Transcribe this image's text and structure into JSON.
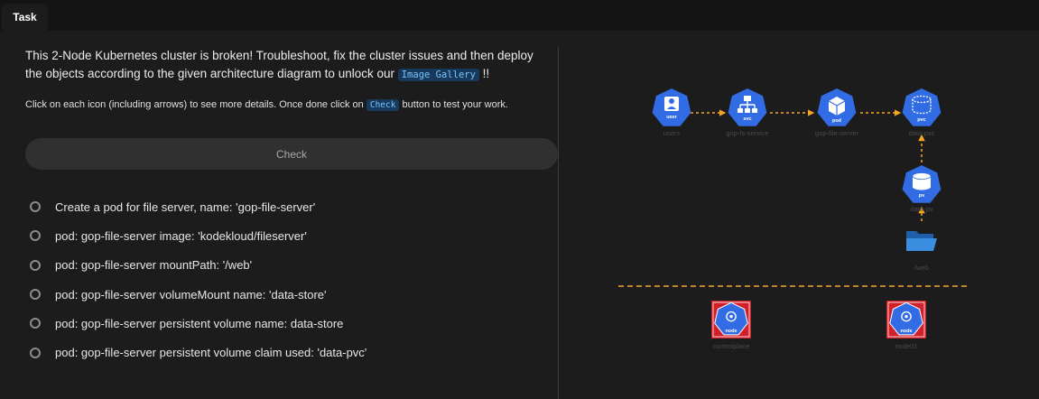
{
  "tab": {
    "label": "Task"
  },
  "intro": {
    "line1": "This 2-Node Kubernetes cluster is broken! Troubleshoot, fix the cluster issues and then deploy",
    "line2_pre": "the objects according to the given architecture diagram to unlock our ",
    "line2_code": "Image Gallery",
    "line2_post": " !!"
  },
  "hint": {
    "pre": "Click on each icon (including arrows) to see more details. Once done click on ",
    "code": "Check",
    "post": " button to test your work."
  },
  "check_button": {
    "label": "Check"
  },
  "tasks": [
    "Create a pod for file server, name: 'gop-file-server'",
    "pod: gop-file-server image: 'kodekloud/fileserver'",
    "pod: gop-file-server mountPath: '/web'",
    "pod: gop-file-server volumeMount name: 'data-store'",
    "pod: gop-file-server persistent volume name: data-store",
    "pod: gop-file-server persistent volume claim used: 'data-pvc'"
  ],
  "diagram": {
    "users": {
      "badge": "user",
      "label": "users"
    },
    "svc": {
      "badge": "svc",
      "label": "gop-fs-service"
    },
    "pod": {
      "badge": "pod",
      "label": "gop-file-server"
    },
    "pvc": {
      "badge": "pvc",
      "label": "data-pvc"
    },
    "pv": {
      "badge": "pv",
      "label": "data-pv"
    },
    "folder": {
      "label": "/web"
    },
    "controlplane": {
      "badge": "node",
      "label": "controlplane"
    },
    "node01": {
      "badge": "node",
      "label": "node01"
    }
  },
  "colors": {
    "k8s_blue": "#326ce5",
    "arrow_orange": "#f5a623",
    "node_red": "#d0202a"
  }
}
